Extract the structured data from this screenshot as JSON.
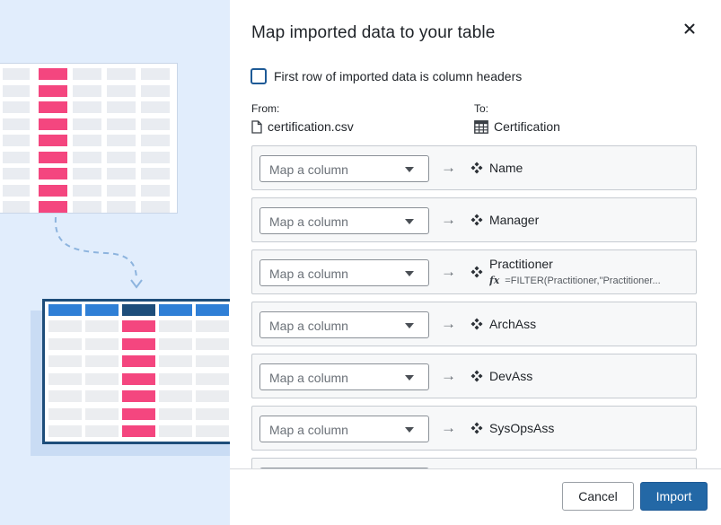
{
  "dialog": {
    "title": "Map imported data to your table",
    "close_icon": "close-icon",
    "header_checkbox": {
      "label": "First row of imported data is column headers",
      "checked": false
    },
    "from": {
      "label": "From:",
      "value": "certification.csv",
      "icon": "file-icon"
    },
    "to": {
      "label": "To:",
      "value": "Certification",
      "icon": "table-icon"
    },
    "select_placeholder": "Map a column",
    "rows": [
      {
        "field": "Name",
        "formula": ""
      },
      {
        "field": "Manager",
        "formula": ""
      },
      {
        "field": "Practitioner",
        "formula": "=FILTER(Practitioner,\"Practitioner..."
      },
      {
        "field": "ArchAss",
        "formula": ""
      },
      {
        "field": "DevAss",
        "formula": ""
      },
      {
        "field": "SysOpsAss",
        "formula": ""
      }
    ],
    "buttons": {
      "cancel": "Cancel",
      "import": "Import"
    }
  },
  "colors": {
    "illustration_bg": "#e1edfc",
    "accent_pink": "#f4467f",
    "primary_button": "#2368a6",
    "table_header_blue": "#2f7fd6",
    "table_border_dark": "#1d4d7a"
  }
}
